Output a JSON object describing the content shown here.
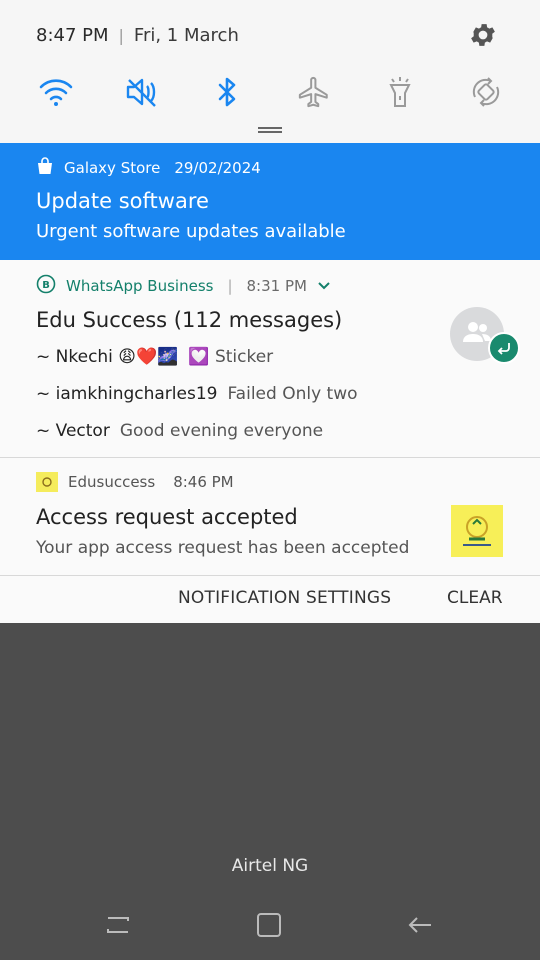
{
  "status": {
    "time": "8:47 PM",
    "separator": "|",
    "date": "Fri, 1 March"
  },
  "quick_settings": [
    {
      "icon": "wifi-icon",
      "active": true
    },
    {
      "icon": "sound-off-icon",
      "active": true
    },
    {
      "icon": "bluetooth-icon",
      "active": true
    },
    {
      "icon": "airplane-icon",
      "active": false
    },
    {
      "icon": "flashlight-icon",
      "active": false
    },
    {
      "icon": "auto-rotate-icon",
      "active": false
    }
  ],
  "notifications": {
    "galaxy_store": {
      "app": "Galaxy Store",
      "date": "29/02/2024",
      "title": "Update software",
      "body": "Urgent software updates available"
    },
    "whatsapp": {
      "app": "WhatsApp Business",
      "separator": "|",
      "time": "8:31 PM",
      "title": "Edu Success (112 messages)",
      "messages": [
        {
          "sender": "~ Nkechi 😩❤️🌌",
          "text": "💟 Sticker"
        },
        {
          "sender": "~ iamkhingcharles19",
          "text": "Failed Only two"
        },
        {
          "sender": "~ Vector",
          "text": "Good evening everyone"
        }
      ]
    },
    "edusuccess": {
      "app": "Edusuccess",
      "time": "8:46 PM",
      "title": "Access request accepted",
      "body": "Your app access request has been accepted"
    }
  },
  "actions": {
    "settings_label": "NOTIFICATION SETTINGS",
    "clear_label": "CLEAR"
  },
  "carrier": "Airtel NG",
  "colors": {
    "accent_blue": "#1a86f0",
    "whatsapp_green": "#14806b"
  }
}
